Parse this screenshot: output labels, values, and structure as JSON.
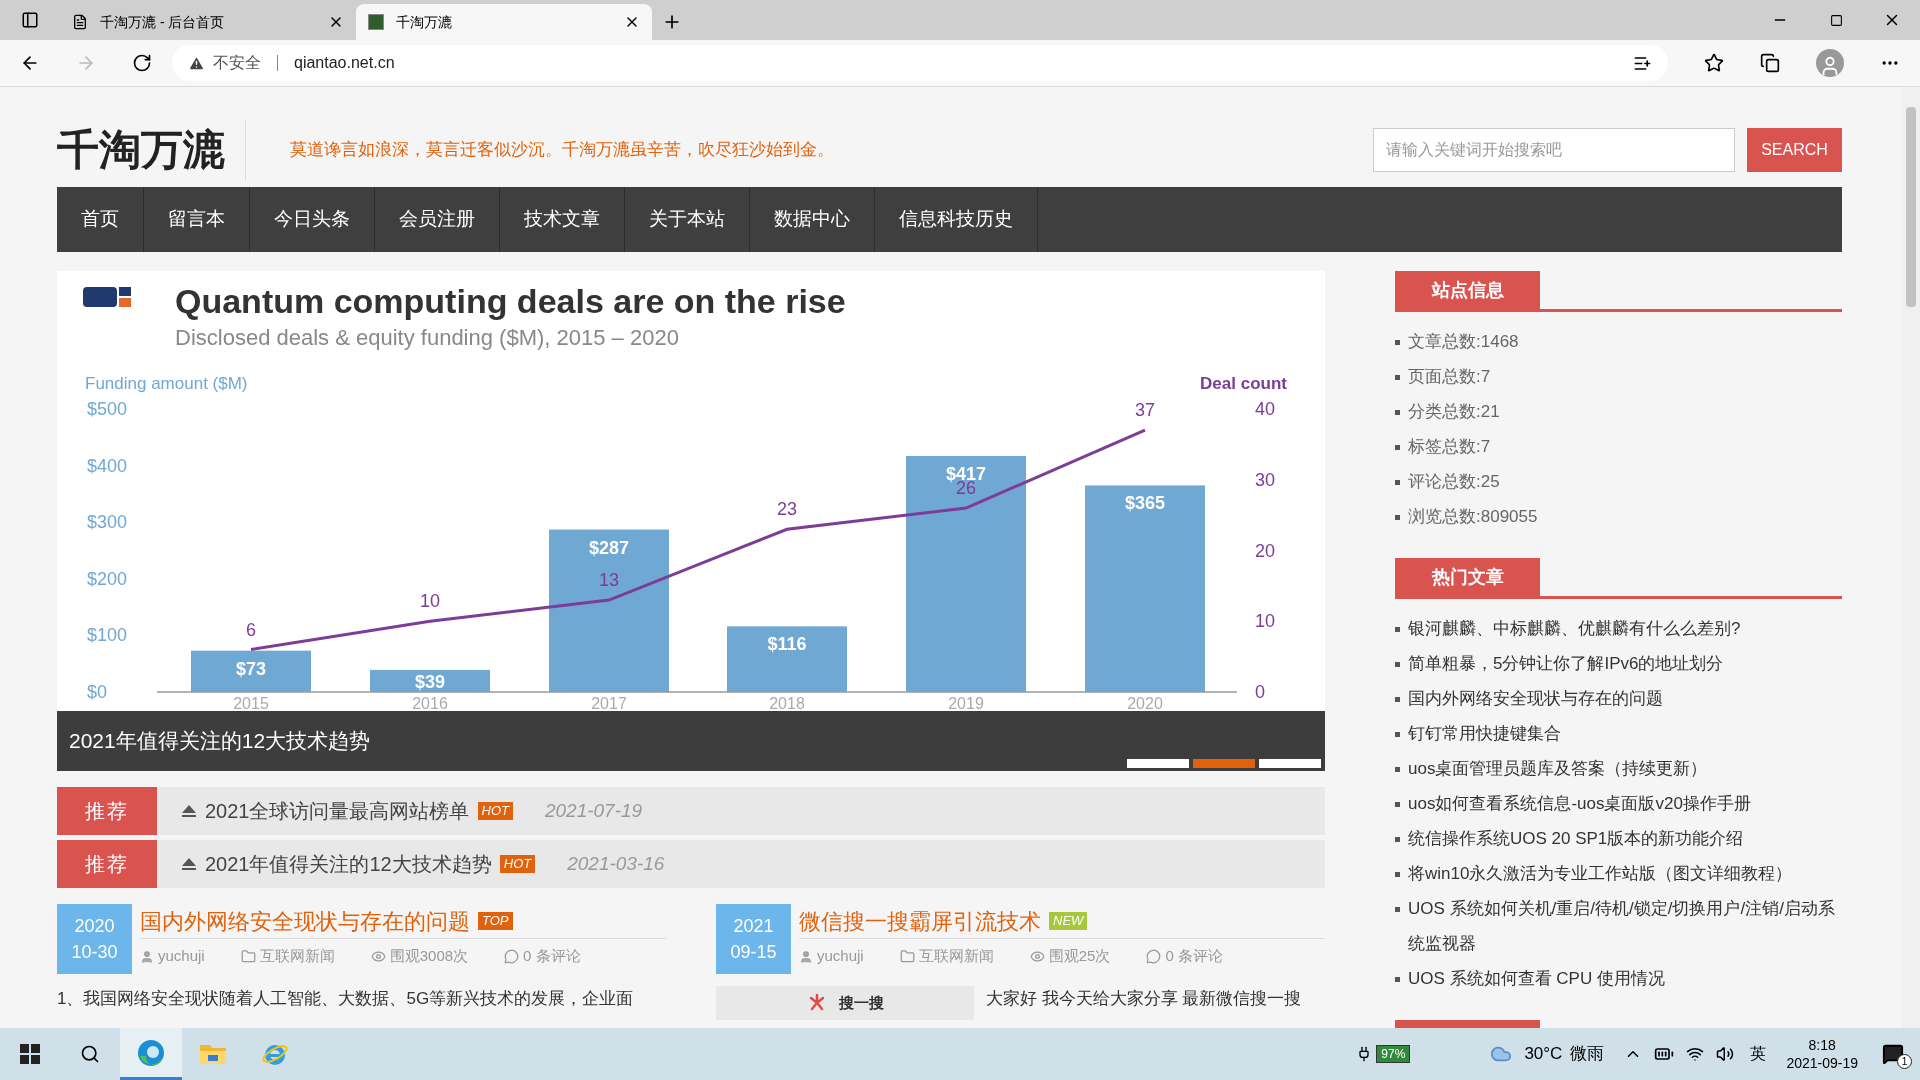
{
  "browser": {
    "tabs": [
      {
        "title": "千淘万漉 - 后台首页",
        "selected": false
      },
      {
        "title": "千淘万漉",
        "selected": true
      }
    ],
    "security": "不安全",
    "url": "qiantao.net.cn"
  },
  "header": {
    "logo": "千淘万漉",
    "slogan": "莫道谗言如浪深，莫言迁客似沙沉。千淘万漉虽辛苦，吹尽狂沙始到金。",
    "search": {
      "placeholder": "请输入关键词开始搜索吧",
      "button": "SEARCH"
    }
  },
  "nav": [
    "首页",
    "留言本",
    "今日头条",
    "会员注册",
    "技术文章",
    "关于本站",
    "数据中心",
    "信息科技历史"
  ],
  "slider": {
    "caption": "2021年值得关注的12大技术趋势",
    "subtitle": "Disclosed deals & equity funding ($M), 2015 – 2020",
    "chart_data": {
      "type": "bar",
      "title": "Quantum computing deals are on the rise",
      "categories": [
        "2015",
        "2016",
        "2017",
        "2018",
        "2019",
        "2020"
      ],
      "series": [
        {
          "name": "Funding amount ($M)",
          "type": "bar",
          "color": "#6fa8d3",
          "values": [
            73,
            39,
            287,
            116,
            417,
            365
          ],
          "value_labels": [
            "$73",
            "$39",
            "$287",
            "$116",
            "$417",
            "$365"
          ]
        },
        {
          "name": "Deal count",
          "type": "line",
          "axis": "y2",
          "color": "#7d3c98",
          "values": [
            6,
            10,
            13,
            23,
            26,
            37
          ],
          "value_labels": [
            "6",
            "10",
            "13",
            "23",
            "26",
            "37"
          ]
        }
      ],
      "ylim": [
        0,
        500
      ],
      "yticks": [
        {
          "value": 0,
          "label": "$0"
        },
        {
          "value": 100,
          "label": "$100"
        },
        {
          "value": 200,
          "label": "$200"
        },
        {
          "value": 300,
          "label": "$300"
        },
        {
          "value": 400,
          "label": "$400"
        },
        {
          "value": 500,
          "label": "$500"
        }
      ],
      "y2lim": [
        0,
        40
      ],
      "y2ticks": [
        0,
        10,
        20,
        30,
        40
      ],
      "stacked": false,
      "data_labels": true
    },
    "dots": [
      {
        "selected": false
      },
      {
        "selected": true
      },
      {
        "selected": false
      }
    ]
  },
  "recommend": [
    {
      "badge": "推荐",
      "title": "2021全球访问量最高网站榜单",
      "tag": {
        "text": "HOT",
        "kind": "hot"
      },
      "date": "2021-07-19"
    },
    {
      "badge": "推荐",
      "title": "2021年值得关注的12大技术趋势",
      "tag": {
        "text": "HOT",
        "kind": "hot"
      },
      "date": "2021-03-16"
    }
  ],
  "posts": [
    {
      "year": "2020",
      "day": "10-30",
      "title": "国内外网络安全现状与存在的问题",
      "tag": {
        "text": "TOP",
        "kind": "top"
      },
      "author": "yuchuji",
      "category": "互联网新闻",
      "views": "围观3008次",
      "comments": "0 条评论",
      "excerpt": "1、我国网络安全现状随着人工智能、大数据、5G等新兴技术的发展，企业面"
    },
    {
      "year": "2021",
      "day": "09-15",
      "title": "微信搜一搜霸屏引流技术",
      "tag": {
        "text": "NEW",
        "kind": "new"
      },
      "author": "yuchuji",
      "category": "互联网新闻",
      "views": "围观25次",
      "comments": "0 条评论",
      "thumb": "搜一搜",
      "excerpt": "大家好 我今天给大家分享 最新微信搜一搜"
    }
  ],
  "sidebar": [
    {
      "title": "站点信息",
      "items": [
        "文章总数:1468",
        "页面总数:7",
        "分类总数:21",
        "标签总数:7",
        "评论总数:25",
        "浏览总数:809055"
      ]
    },
    {
      "title": "热门文章",
      "items": [
        "银河麒麟、中标麒麟、优麒麟有什么么差别?",
        "简单粗暴，5分钟让你了解IPv6的地址划分",
        "国内外网络安全现状与存在的问题",
        "钉钉常用快捷键集合",
        "uos桌面管理员题库及答案（持续更新）",
        "uos如何查看系统信息-uos桌面版v20操作手册",
        "统信操作系统UOS 20 SP1版本的新功能介绍",
        "将win10永久激活为专业工作站版（图文详细教程）",
        "UOS 系统如何关机/重启/待机/锁定/切换用户/注销/启动系统监视器",
        "UOS 系统如何查看 CPU 使用情况"
      ]
    }
  ],
  "taskbar": {
    "battery": "97%",
    "temperature": "30°C",
    "weather": "微雨",
    "ime": "英",
    "time": "8:18",
    "date": "2021-09-19",
    "notifications": "1"
  }
}
